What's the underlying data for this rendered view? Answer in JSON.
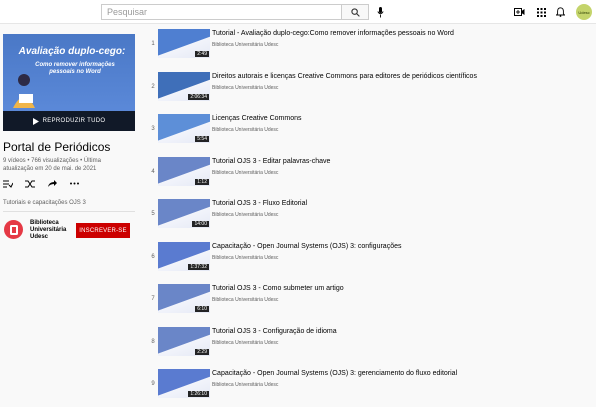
{
  "header": {
    "search_placeholder": "Pesquisar",
    "avatar_text": "Udesc"
  },
  "playlist": {
    "cover_title": "Avaliação duplo-cego:",
    "cover_subtitle": "Como remover informações pessoais no Word",
    "play_all": "REPRODUZIR TUDO",
    "title": "Portal de Periódicos",
    "stats": "9 vídeos • 766 visualizações • Última atualização em 20 de mai. de 2021",
    "description": "Tutoriais e capacitações OJS 3",
    "owner": "Biblioteca Universitária Udesc",
    "subscribe": "INSCREVER-SE"
  },
  "videos": [
    {
      "index": "1",
      "title": "Tutorial - Avaliação duplo-cego:Como remover informações pessoais no Word",
      "channel": "Biblioteca Universitária Udesc",
      "duration": "2:49",
      "thumb": "#4f7fd1"
    },
    {
      "index": "2",
      "title": "Direitos autorais e licenças Creative Commons para editores de periódicos científicos",
      "channel": "Biblioteca Universitária Udesc",
      "duration": "2:06:34",
      "thumb": "#3f6fb9"
    },
    {
      "index": "3",
      "title": "Licenças Creative Commons",
      "channel": "Biblioteca Universitária Udesc",
      "duration": "5:54",
      "thumb": "#5d8fd8"
    },
    {
      "index": "4",
      "title": "Tutorial OJS 3 - Editar palavras-chave",
      "channel": "Biblioteca Universitária Udesc",
      "duration": "1:12",
      "thumb": "#6a86c8"
    },
    {
      "index": "5",
      "title": "Tutorial OJS 3 - Fluxo Editorial",
      "channel": "Biblioteca Universitária Udesc",
      "duration": "14:00",
      "thumb": "#6a86c8"
    },
    {
      "index": "6",
      "title": "Capacitação - Open Journal Systems (OJS) 3: configurações",
      "channel": "Biblioteca Universitária Udesc",
      "duration": "1:37:32",
      "thumb": "#5a7bd0"
    },
    {
      "index": "7",
      "title": "Tutorial OJS 3 - Como submeter um artigo",
      "channel": "Biblioteca Universitária Udesc",
      "duration": "6:10",
      "thumb": "#6a86c8"
    },
    {
      "index": "8",
      "title": "Tutorial OJS 3 - Configuração de idioma",
      "channel": "Biblioteca Universitária Udesc",
      "duration": "2:29",
      "thumb": "#6a86c8"
    },
    {
      "index": "9",
      "title": "Capacitação - Open Journal Systems (OJS) 3: gerenciamento do fluxo editorial",
      "channel": "Biblioteca Universitária Udesc",
      "duration": "1:26:10",
      "thumb": "#5a7bd0"
    }
  ]
}
